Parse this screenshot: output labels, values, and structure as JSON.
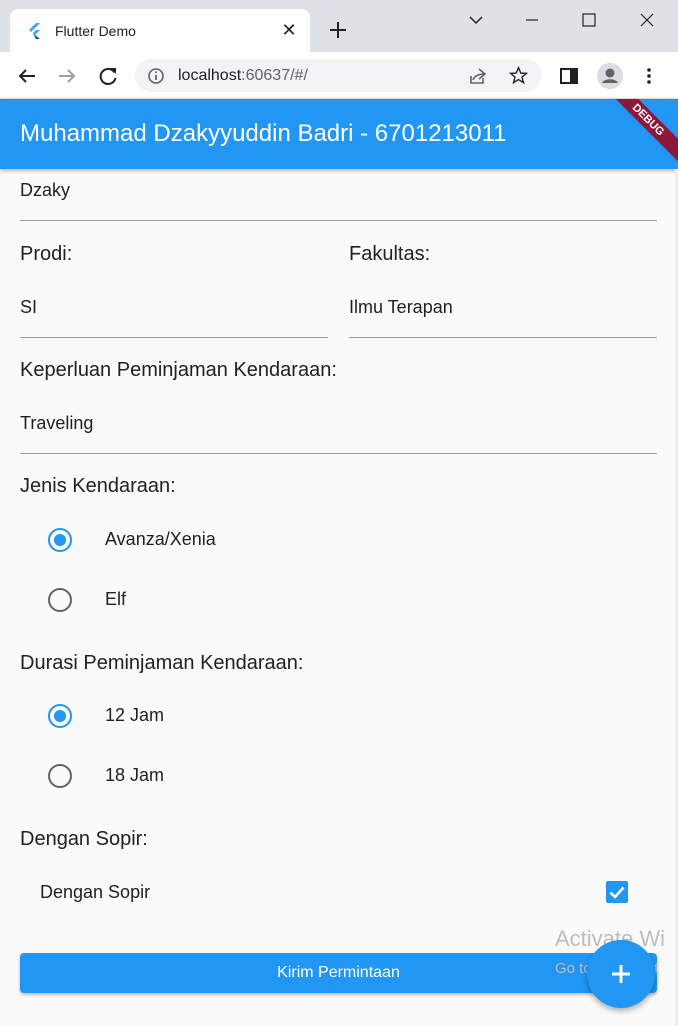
{
  "browser": {
    "tab_title": "Flutter Demo",
    "tab_close": "✕",
    "url_host": "localhost",
    "url_rest": ":60637/#/"
  },
  "app": {
    "title": "Muhammad Dzakyyuddin Badri - 6701213011",
    "debug_banner": "DEBUG",
    "accent_color": "#2196f3"
  },
  "form": {
    "nama_value": "Dzaky",
    "prodi_label": "Prodi:",
    "prodi_value": "SI",
    "fakultas_label": "Fakultas:",
    "fakultas_value": "Ilmu Terapan",
    "keperluan_label": "Keperluan Peminjaman Kendaraan:",
    "keperluan_value": "Traveling",
    "jenis_label": "Jenis Kendaraan:",
    "jenis_options": [
      {
        "label": "Avanza/Xenia",
        "selected": true
      },
      {
        "label": "Elf",
        "selected": false
      }
    ],
    "durasi_label": "Durasi Peminjaman Kendaraan:",
    "durasi_options": [
      {
        "label": "12 Jam",
        "selected": true
      },
      {
        "label": "18 Jam",
        "selected": false
      }
    ],
    "sopir_label": "Dengan Sopir:",
    "sopir_checkbox_label": "Dengan Sopir",
    "sopir_checked": true,
    "submit_label": "Kirim Permintaan"
  },
  "watermark": {
    "line1": "Activate Wi",
    "line2": "Go to Settings t"
  }
}
